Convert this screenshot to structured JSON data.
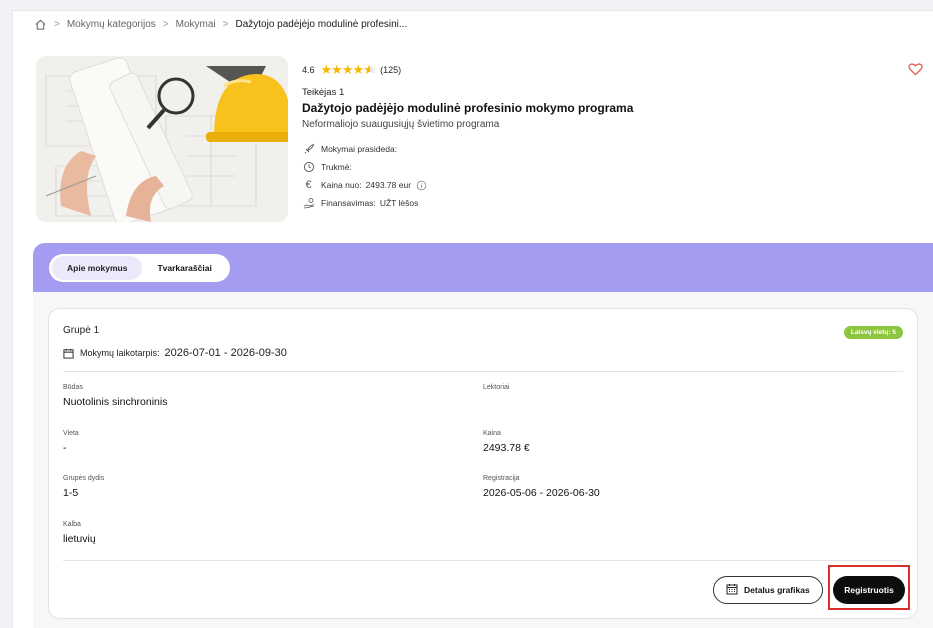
{
  "breadcrumb": {
    "items": [
      "Mokymų kategorijos",
      "Mokymai"
    ],
    "current": "Dažytojo padėjėjo modulinė profesini..."
  },
  "course": {
    "rating": "4.6",
    "stars_value": 4.5,
    "reviews": "(125)",
    "provider": "Teikėjas 1",
    "title": "Dažytojo padėjėjo modulinė profesinio mokymo programa",
    "subtitle": "Neformaliojo suaugusiųjų švietimo programa",
    "meta": {
      "start_label": "Mokymai prasideda:",
      "duration_label": "Trukmė:",
      "price_label": "Kaina nuo:",
      "price_value": "2493.78 eur",
      "funding_label": "Finansavimas:",
      "funding_value": "UŽT lėšos"
    },
    "icons": [
      "rocket-icon",
      "clock-icon",
      "euro-icon",
      "hand-coins-icon",
      "info-icon",
      "heart-icon"
    ]
  },
  "tabs": {
    "about": "Apie mokymus",
    "schedules": "Tvarkaraščiai"
  },
  "group": {
    "title": "Grupė 1",
    "period_label": "Mokymų laikotarpis:",
    "period_value": "2026-07-01 - 2026-09-30",
    "badge": "Laisvų vietų: 5",
    "fields": {
      "mode_label": "Būdas",
      "mode_value": "Nuotolinis sinchroninis",
      "lecturers_label": "Lektoriai",
      "lecturers_value": "",
      "place_label": "Vieta",
      "place_value": "-",
      "price_label": "Kaina",
      "price_value": "2493.78 €",
      "size_label": "Grupės dydis",
      "size_value": "1-5",
      "registration_label": "Registracija",
      "registration_value": "2026-05-06 - 2026-06-30",
      "language_label": "Kalba",
      "language_value": "lietuvių"
    },
    "buttons": {
      "schedule": "Detalus grafikas",
      "register": "Registruotis"
    }
  },
  "colors": {
    "accent_purple": "#a49cf0",
    "badge_green": "#8cc63f",
    "star_gold": "#f5b800",
    "heart": "#e0604a",
    "highlight_red": "#d9302c"
  }
}
